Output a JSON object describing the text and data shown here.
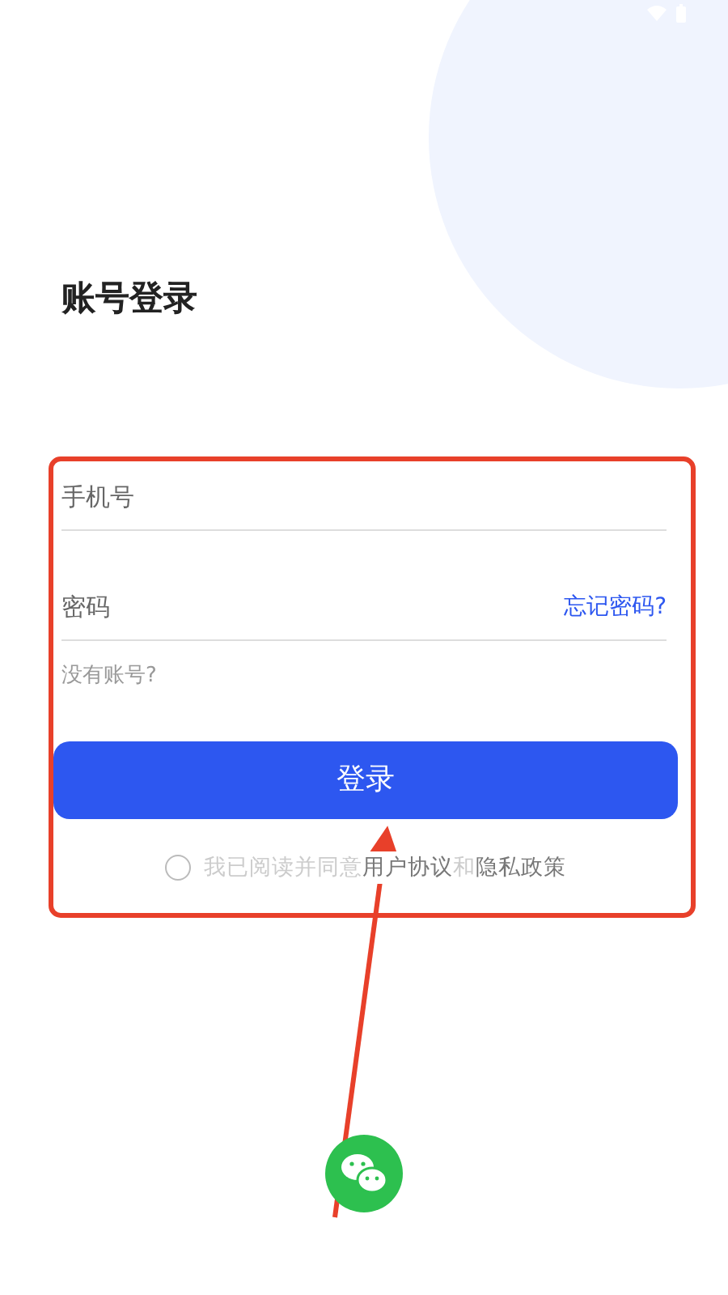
{
  "title": "账号登录",
  "phone_field": {
    "placeholder": "手机号"
  },
  "password_field": {
    "placeholder": "密码"
  },
  "forgot_link": "忘记密码?",
  "register_link": "没有账号?",
  "login_button": "登录",
  "agreement": {
    "checked": false,
    "parts": [
      {
        "kind": "text",
        "text": "我已阅读并同意"
      },
      {
        "kind": "link",
        "text": "用户协议"
      },
      {
        "kind": "text",
        "text": "和"
      },
      {
        "kind": "link",
        "text": "隐私政策"
      }
    ]
  }
}
